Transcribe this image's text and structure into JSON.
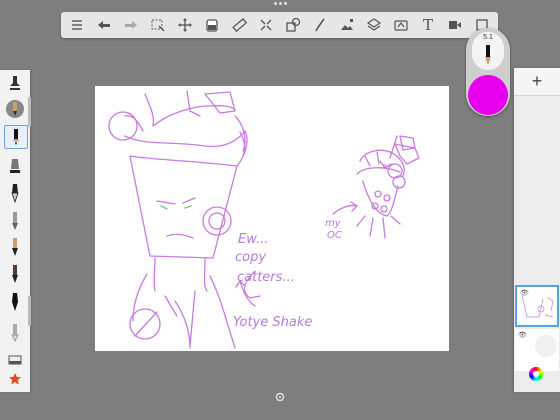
{
  "app": {
    "background": "#7e7e7e",
    "canvas_bg": "#ffffff"
  },
  "toolbar": {
    "tools": [
      "list-icon",
      "undo-icon",
      "redo-icon",
      "select-icon",
      "transform-icon",
      "fill-icon",
      "ruler-icon",
      "symmetry-icon",
      "shape-icon",
      "pen-icon",
      "image-icon",
      "layers-stack-icon",
      "guides-icon",
      "text-icon",
      "video-icon",
      "fullscreen-icon"
    ],
    "text_tool_glyph": "T"
  },
  "color_puck": {
    "brush_size": "5.1",
    "current_color": "#e600ee"
  },
  "layers": {
    "add_label": "+"
  },
  "drawing": {
    "note1_line1": "Ew...",
    "note1_line2": "copy",
    "note1_line3": "catters...",
    "note2": "Yotye Shake",
    "note3_line1": "my",
    "note3_line2": "OC"
  }
}
